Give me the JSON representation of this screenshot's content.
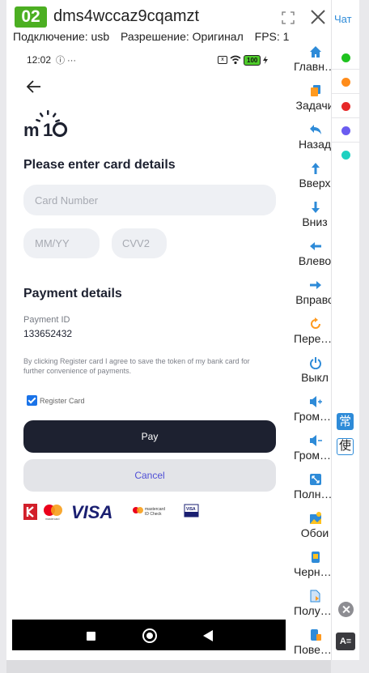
{
  "header": {
    "badge": "02",
    "device_id": "dms4wccaz9cqamzt",
    "connection": "Подключение: usb",
    "resolution": "Разрешение: Оригинал",
    "fps": "FPS: 1"
  },
  "phone": {
    "status_time": "12:02",
    "status_icons": "ⓘ ···",
    "battery": "100",
    "sim_icon": "x",
    "logo": "m10",
    "card_heading": "Please enter card details",
    "card_number_placeholder": "Card Number",
    "mmyy_placeholder": "MM/YY",
    "cvv_placeholder": "CVV2",
    "payment_heading": "Payment details",
    "payment_id_label": "Payment ID",
    "payment_id_value": "133652432",
    "consent_text": "By clicking Register card I agree to save the token of my bank card for further convenience of payments.",
    "register_card_label": "Register Card",
    "register_card_checked": true,
    "pay_button": "Pay",
    "cancel_button": "Cancel",
    "brands": {
      "visa": "VISA",
      "mc_small": "mastercard",
      "mc_idcheck_1": "mastercard",
      "mc_idcheck_2": "ID Check",
      "visa_secure": "VISA"
    }
  },
  "sidebar": {
    "items": [
      {
        "label": "Главная",
        "icon": "home-icon"
      },
      {
        "label": "Задачи",
        "icon": "tasks-icon"
      },
      {
        "label": "Назад",
        "icon": "back-icon"
      },
      {
        "label": "Вверх",
        "icon": "arrow-up-icon"
      },
      {
        "label": "Вниз",
        "icon": "arrow-down-icon"
      },
      {
        "label": "Влево",
        "icon": "arrow-left-icon"
      },
      {
        "label": "Вправо",
        "icon": "arrow-right-icon"
      },
      {
        "label": "Перезагрузка",
        "icon": "restart-icon"
      },
      {
        "label": "Выкл",
        "icon": "power-icon"
      },
      {
        "label": "Громкость+",
        "icon": "volume-up-icon"
      },
      {
        "label": "Громкость-",
        "icon": "volume-down-icon"
      },
      {
        "label": "Полный экран",
        "icon": "fullscreen-icon"
      },
      {
        "label": "Обои",
        "icon": "wallpaper-icon"
      },
      {
        "label": "Черный экран",
        "icon": "black-screen-icon"
      },
      {
        "label": "Получить",
        "icon": "get-file-icon"
      },
      {
        "label": "Повернуть",
        "icon": "rotate-icon"
      }
    ]
  },
  "right_column": {
    "chat_label": "Чат",
    "dots": [
      "#1fc21f",
      "#ff8c1a",
      "#e62828",
      "#6a5cf0",
      "#1fd1c1"
    ],
    "ime_1": "常",
    "ime_2": "使",
    "font_button": "A≡"
  },
  "colors": {
    "badge": "#4caf22",
    "pay_button": "#1d2130",
    "cancel_text": "#4f4fd6",
    "accent": "#2e8bd8"
  }
}
